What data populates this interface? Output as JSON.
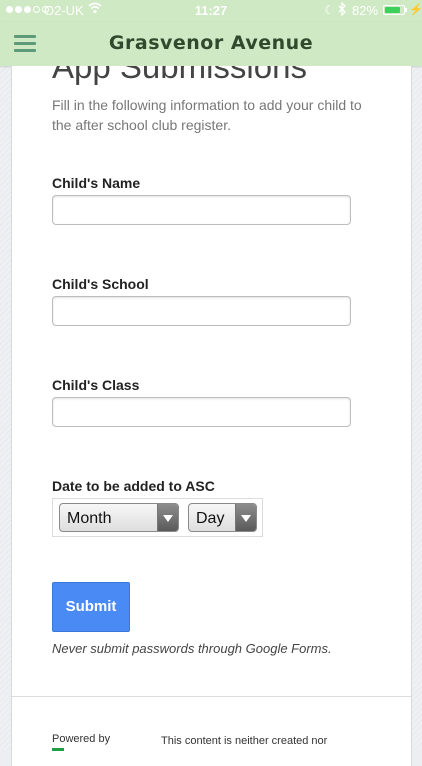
{
  "status_bar": {
    "carrier": "O2-UK",
    "time": "11:27",
    "battery_percent": "82%",
    "battery_level": 0.82
  },
  "header": {
    "title": "Grasvenor Avenue"
  },
  "form": {
    "title": "App Submissions",
    "description": "Fill in the following information to add your child to the after school club register.",
    "fields": [
      {
        "label": "Child's Name",
        "value": ""
      },
      {
        "label": "Child's School",
        "value": ""
      },
      {
        "label": "Child's Class",
        "value": ""
      }
    ],
    "date": {
      "label": "Date to be added to ASC",
      "month": "Month",
      "day": "Day"
    },
    "submit_label": "Submit",
    "password_warning": "Never submit passwords through Google Forms.",
    "powered_by": "Powered by",
    "disclaimer": "This content is neither created nor"
  },
  "colors": {
    "header_bg": "#cfe9c4",
    "header_title": "#2f4a2c",
    "submit_bg": "#4a8af4"
  }
}
